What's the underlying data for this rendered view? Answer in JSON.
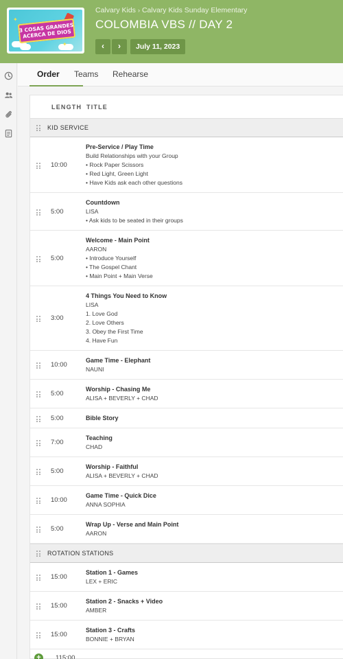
{
  "header": {
    "artwork_text_line1": "3 COSAS GRANDES",
    "artwork_text_line2": "ACERCA DE DIOS",
    "breadcrumb": [
      "Calvary Kids",
      "Calvary Kids Sunday Elementary"
    ],
    "breadcrumb_separator": "›",
    "title": "COLOMBIA VBS // DAY 2",
    "prev_label": "‹",
    "next_label": "›",
    "date": "July 11, 2023",
    "bg_color": "#8fb665"
  },
  "tabs": [
    {
      "label": "Order",
      "active": true
    },
    {
      "label": "Teams",
      "active": false
    },
    {
      "label": "Rehearse",
      "active": false
    }
  ],
  "columns": {
    "length": "LENGTH",
    "title": "TITLE"
  },
  "sections": [
    {
      "label": "KID SERVICE",
      "items": [
        {
          "length": "10:00",
          "title": "Pre-Service / Play Time",
          "lines": [
            "Build Relationships with your Group",
            "• Rock Paper Scissors",
            "• Red Light, Green Light",
            "• Have Kids ask each other questions"
          ]
        },
        {
          "length": "5:00",
          "title": "Countdown",
          "lines": [
            "LISA",
            "• Ask kids to be seated in their groups"
          ]
        },
        {
          "length": "5:00",
          "title": "Welcome - Main Point",
          "lines": [
            "AARON",
            "• Introduce Yourself",
            "• The Gospel Chant",
            "• Main Point + Main Verse"
          ]
        },
        {
          "length": "3:00",
          "title": "4 Things You Need to Know",
          "lines": [
            "LISA",
            "1. Love God",
            "2. Love Others",
            "3. Obey the First Time",
            "4. Have Fun"
          ]
        },
        {
          "length": "10:00",
          "title": "Game Time - Elephant",
          "lines": [
            "NAUNI"
          ]
        },
        {
          "length": "5:00",
          "title": "Worship - Chasing Me",
          "lines": [
            "ALISA + BEVERLY + CHAD"
          ]
        },
        {
          "length": "5:00",
          "title": "Bible Story",
          "lines": []
        },
        {
          "length": "7:00",
          "title": "Teaching",
          "lines": [
            "CHAD"
          ]
        },
        {
          "length": "5:00",
          "title": "Worship - Faithful",
          "lines": [
            "ALISA + BEVERLY + CHAD"
          ]
        },
        {
          "length": "10:00",
          "title": "Game Time - Quick Dice",
          "lines": [
            "ANNA SOPHIA"
          ]
        },
        {
          "length": "5:00",
          "title": "Wrap Up - Verse and Main Point",
          "lines": [
            "AARON"
          ]
        }
      ]
    },
    {
      "label": "ROTATION STATIONS",
      "items": [
        {
          "length": "15:00",
          "title": "Station 1 - Games",
          "lines": [
            "LEX + ERIC"
          ]
        },
        {
          "length": "15:00",
          "title": "Station 2 - Snacks + Video",
          "lines": [
            "AMBER"
          ]
        },
        {
          "length": "15:00",
          "title": "Station 3 - Crafts",
          "lines": [
            "BONNIE + BRYAN"
          ]
        }
      ]
    }
  ],
  "footer": {
    "add_label": "+",
    "total_length": "115:00"
  }
}
